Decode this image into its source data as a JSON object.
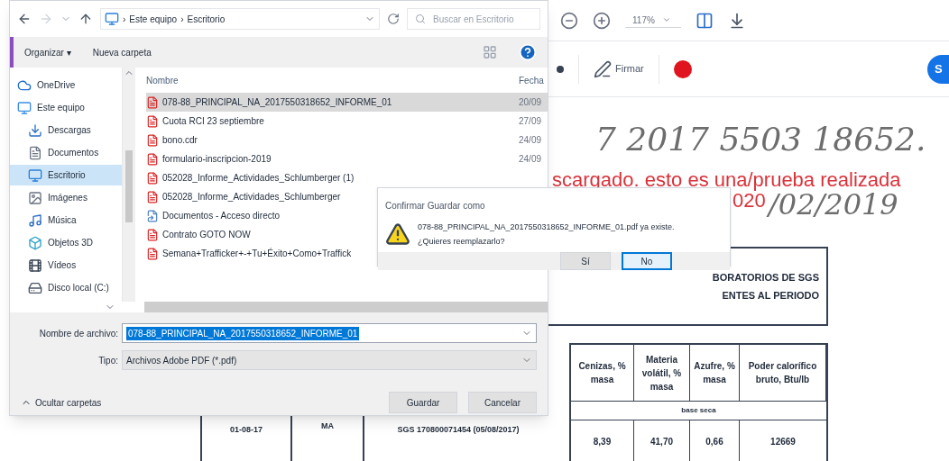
{
  "pdf_viewer": {
    "zoom": "117%",
    "sign_label": "Firmar",
    "share_button": "S",
    "document": {
      "handwritten_number": "7  2017 5503 18652.",
      "overlay_text": "scargado. esto es una/prueba realizada",
      "overlay_text_2": "020",
      "handwritten_date": "/02/2019",
      "heading_lines": [
        "BORATORIOS DE SGS",
        "ENTES  AL PERIODO"
      ],
      "table": {
        "columns": [
          "Cenizas, % masa",
          "Materia volátil, % masa",
          "Azufre, % masa",
          "Poder calorífico bruto, Btu/lb"
        ],
        "subheader": "base seca",
        "row": [
          "8,39",
          "41,70",
          "0,66",
          "12669"
        ]
      },
      "left_cells": [
        "01-08-17",
        "MA",
        "SGS 170800071454 (05/08/2017)"
      ]
    }
  },
  "save_dialog": {
    "breadcrumb_separator": "›",
    "breadcrumb": [
      "Este equipo",
      "Escritorio"
    ],
    "search_placeholder": "Buscar en Escritorio",
    "organize": "Organizar ▾",
    "new_folder": "Nueva carpeta",
    "sidebar": [
      {
        "label": "OneDrive",
        "kind": "cloud",
        "selected": false
      },
      {
        "label": "Este equipo",
        "kind": "pc",
        "selected": false
      },
      {
        "label": "Descargas",
        "kind": "download",
        "selected": false
      },
      {
        "label": "Documentos",
        "kind": "docs",
        "selected": false
      },
      {
        "label": "Escritorio",
        "kind": "desktop",
        "selected": true
      },
      {
        "label": "Imágenes",
        "kind": "images",
        "selected": false
      },
      {
        "label": "Música",
        "kind": "music",
        "selected": false
      },
      {
        "label": "Objetos 3D",
        "kind": "cube",
        "selected": false
      },
      {
        "label": "Vídeos",
        "kind": "video",
        "selected": false
      },
      {
        "label": "Disco local (C:)",
        "kind": "disk",
        "selected": false
      }
    ],
    "columns": [
      "Nombre",
      "Fecha"
    ],
    "files": [
      {
        "name": "078-88_PRINCIPAL_NA_2017550318652_INFORME_01",
        "date": "20/09",
        "kind": "pdf",
        "selected": true
      },
      {
        "name": "Cuota RCI 23 septiembre",
        "date": "27/09",
        "kind": "pdf",
        "selected": false
      },
      {
        "name": "bono.cdr",
        "date": "24/09",
        "kind": "pdf",
        "selected": false
      },
      {
        "name": "formulario-inscripcion-2019",
        "date": "24/09",
        "kind": "pdf",
        "selected": false
      },
      {
        "name": "052028_Informe_Actividades_Schlumberger (1)",
        "kind": "pdf",
        "selected": false
      },
      {
        "name": "052028_Informe_Actividades_Schlumberger",
        "kind": "pdf",
        "selected": false
      },
      {
        "name": "Documentos - Acceso directo",
        "kind": "shortcut",
        "selected": false
      },
      {
        "name": "Contrato GOTO NOW",
        "kind": "pdf",
        "selected": false
      },
      {
        "name": "Semana+Trafficker+-+Tu+Éxito+Como+Traffick",
        "kind": "pdf",
        "selected": false
      }
    ],
    "filename_label": "Nombre de archivo:",
    "filename": "078-88_PRINCIPAL_NA_2017550318652_INFORME_01",
    "type_label": "Tipo:",
    "type": "Archivos Adobe PDF (*.pdf)",
    "hide_folders": "Ocultar carpetas",
    "buttons": [
      "Guardar",
      "Cancelar"
    ]
  },
  "confirm_dialog": {
    "title": "Confirmar Guardar como",
    "message": "078-88_PRINCIPAL_NA_2017550318652_INFORME_01.pdf ya existe.",
    "question": "¿Quieres reemplazarlo?",
    "buttons": [
      {
        "label": "Sí",
        "selected": false
      },
      {
        "label": "No",
        "selected": true
      }
    ]
  }
}
